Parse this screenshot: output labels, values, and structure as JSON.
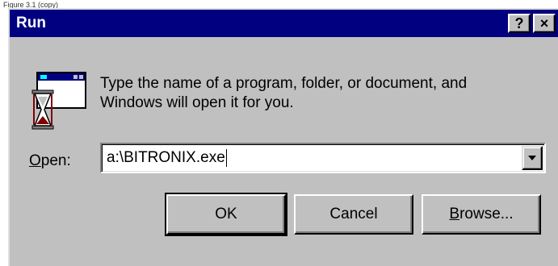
{
  "caption": "Figure 3.1 (copy)",
  "window": {
    "title": "Run",
    "help_button": "?",
    "close_button": "×"
  },
  "description": {
    "line1": "Type the name of a program, folder, or document, and",
    "line2": "Windows will open it for you."
  },
  "open_field": {
    "label_accel": "O",
    "label_rest": "pen:",
    "value": "a:\\BITRONIX.exe"
  },
  "buttons": {
    "ok": "OK",
    "cancel": "Cancel",
    "browse_accel": "B",
    "browse_rest": "rowse..."
  },
  "icons": {
    "run": "run-icon",
    "dropdown": "chevron-down-icon"
  },
  "colors": {
    "titlebar": "#000080",
    "face": "#c0c0c0",
    "input_bg": "#ffffff"
  }
}
